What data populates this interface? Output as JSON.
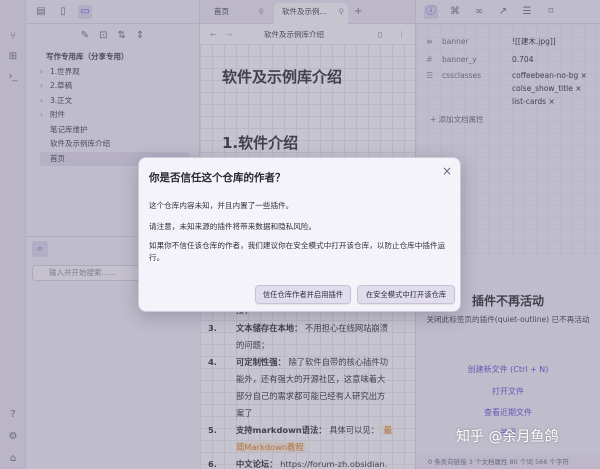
{
  "file_tree": {
    "vault_name": "写作专用库（分享专用）",
    "items": [
      {
        "label": "1.世界观",
        "type": "folder"
      },
      {
        "label": "2.草稿",
        "type": "folder"
      },
      {
        "label": "3.正文",
        "type": "folder"
      },
      {
        "label": "附件",
        "type": "folder"
      },
      {
        "label": "笔记库维护",
        "type": "file"
      },
      {
        "label": "软件及示例库介绍",
        "type": "file"
      },
      {
        "label": "首页",
        "type": "file",
        "selected": true
      }
    ]
  },
  "search": {
    "placeholder": "输入并开始搜索……"
  },
  "editor": {
    "tabs": [
      {
        "label": "首页"
      },
      {
        "label": "软件及示例..."
      }
    ],
    "view_title": "软件及示例库介绍",
    "doc_title": "软件及示例库介绍",
    "heading1": "1.软件介绍",
    "list_fragment_top": "接；",
    "list": [
      {
        "num": "3.",
        "bold": "文本储存在本地：",
        "text": "不用担心在线网站崩溃的问题；"
      },
      {
        "num": "4.",
        "bold": "可定制性强：",
        "text": "除了软件自带的核心插件功能外，还有强大的开源社区，这意味着大部分自己的需求都可能已经有人研究出方案了"
      },
      {
        "num": "5.",
        "bold": "支持markdown语法：",
        "text": "具体可以见：",
        "highlight": "最简Markdown教程"
      },
      {
        "num": "6.",
        "bold": "中文论坛：",
        "text": "https://forum-zh.obsidian.md/"
      }
    ]
  },
  "properties": {
    "rows": [
      {
        "key": "banner",
        "value": "![[建木.jpg]]"
      },
      {
        "key": "banner_y",
        "value": "0.704"
      },
      {
        "key": "cssclasses",
        "values": [
          "coffeebean-no-bg ×",
          "colse_show_title ×",
          "list-cards ×"
        ]
      }
    ],
    "add_label": "+ 添加文档属性"
  },
  "outline_pane": {
    "heading": "插件不再活动",
    "subtext": "关闭此标签页的插件(quiet-outline) 已不再活动",
    "links": [
      "创建新文件 (Ctrl + N)",
      "打开文件",
      "查看近期文件",
      "关闭"
    ]
  },
  "status_bar": {
    "text": "0 条反向链接   3 个文档属性   80 个词   566 个字符"
  },
  "modal": {
    "title": "你是否信任这个仓库的作者？",
    "p1": "这个仓库内容未知，并且内置了一些插件。",
    "p2": "请注意，未知来源的插件将带来数据和隐私风险。",
    "p3": "如果你不信任该仓库的作者，我们建议你在安全模式中打开该仓库，以防止仓库中插件运行。",
    "btn_trust": "信任仓库作者并启用插件",
    "btn_safe": "在安全模式中打开该仓库",
    "close": "×"
  },
  "watermark": "知乎 @余月鱼鸽"
}
